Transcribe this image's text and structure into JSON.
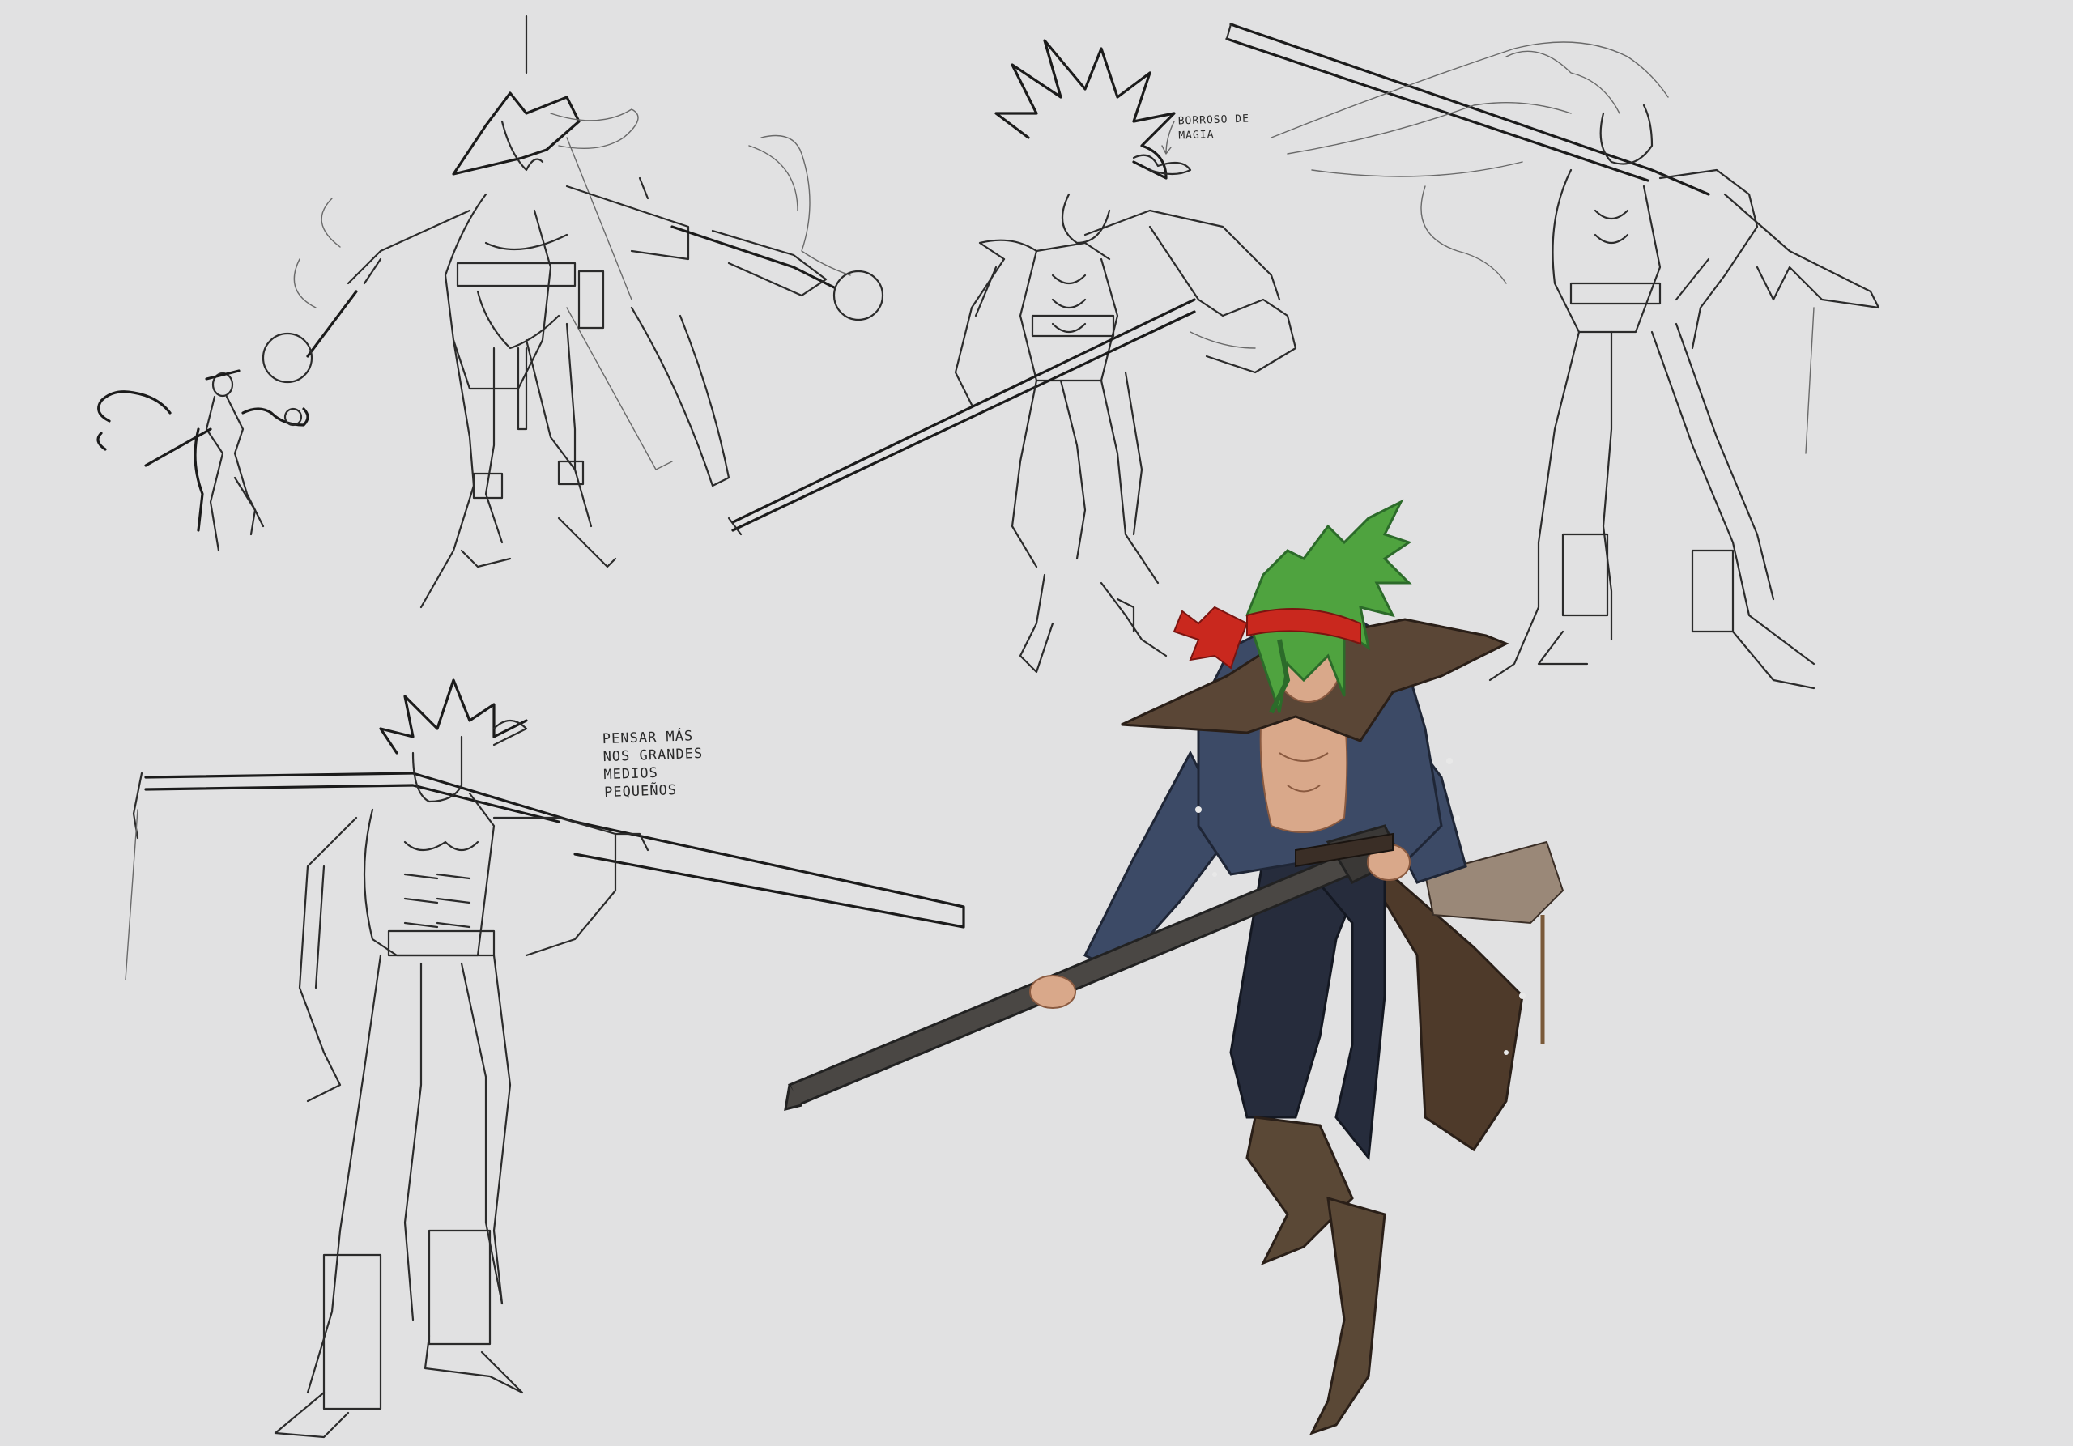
{
  "sheet": {
    "background_color": "#e1e1e2",
    "line_color": "#2b2b2b"
  },
  "annotations": {
    "note_1": "BORROSO DE\nMAGIA",
    "note_2": "PENSAR MÁS\nNOS GRANDES\nMEDIOS\nPEQUEÑOS"
  },
  "palette": {
    "hair": "#4fa33f",
    "hair_dark": "#2c6b2a",
    "bandana": "#c9281e",
    "coat": "#3c4a66",
    "coat_lining": "#5a4636",
    "skin": "#d9a88a",
    "pants": "#262c3c",
    "boots": "#5a4836",
    "rifle": "#4a4744"
  }
}
